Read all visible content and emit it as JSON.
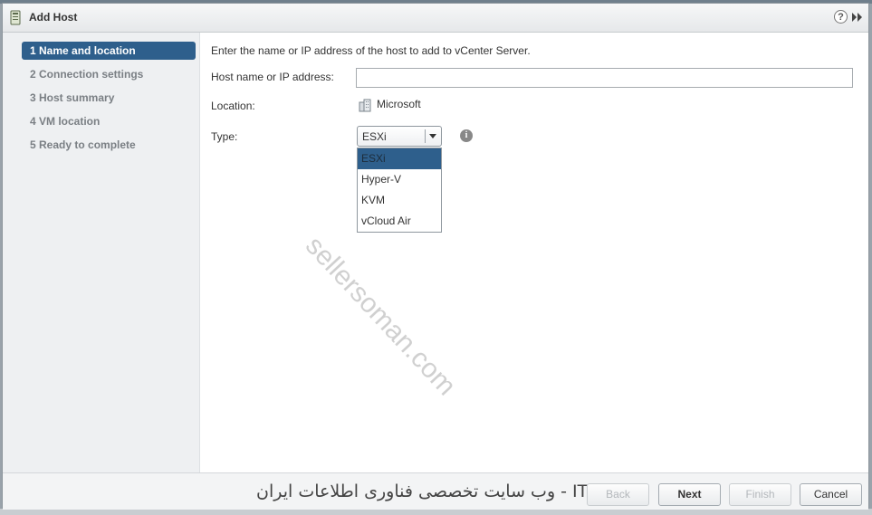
{
  "dialog": {
    "title": "Add Host",
    "icons": {
      "title": "host-icon",
      "help": "help-icon",
      "expand": "double-chevron-right-icon"
    },
    "help_glyph": "?"
  },
  "steps": [
    {
      "label": "1  Name and location",
      "active": true
    },
    {
      "label": "2  Connection settings",
      "active": false
    },
    {
      "label": "3  Host summary",
      "active": false
    },
    {
      "label": "4  VM location",
      "active": false
    },
    {
      "label": "5  Ready to complete",
      "active": false
    }
  ],
  "form": {
    "instruction": "Enter the name or IP address of the host to add to vCenter Server.",
    "host_label": "Host name or IP address:",
    "host_value": "",
    "location_label": "Location:",
    "location_value": "Microsoft",
    "type_label": "Type:",
    "type_selected": "ESXi",
    "type_options": [
      "ESXi",
      "Hyper-V",
      "KVM",
      "vCloud Air"
    ]
  },
  "watermark": "sellersoman.com",
  "footer": {
    "banner": "وب سایت تخصصی فناوری اطلاعات ایران - ITPro.ir",
    "back": "Back",
    "next": "Next",
    "finish": "Finish",
    "cancel": "Cancel"
  },
  "colors": {
    "accent": "#2e5f8c",
    "sidebar": "#eef0f2"
  }
}
